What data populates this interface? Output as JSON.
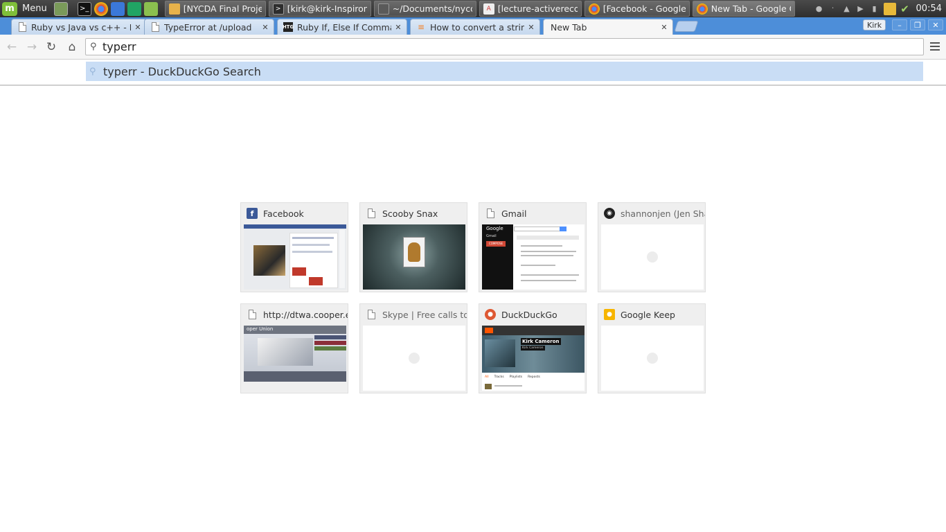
{
  "taskbar": {
    "menu_label": "Menu",
    "tasks": [
      {
        "label": "[NYCDA Final Project]",
        "icon": "folder-icon",
        "color": "#e7b24a"
      },
      {
        "label": "[kirk@kirk-Inspiron-...",
        "icon": "terminal-icon",
        "color": "#2d2d2d"
      },
      {
        "label": "~/Documents/nycd...",
        "icon": "text-editor-icon",
        "color": "#3a3a3a"
      },
      {
        "label": "[lecture-activerecor...",
        "icon": "pdf-icon",
        "color": "#d9d9d9"
      },
      {
        "label": "[Facebook - Google ...",
        "icon": "chrome-icon",
        "color": "#dd4b39"
      },
      {
        "label": "New Tab - Google C...",
        "icon": "chrome-icon",
        "color": "#dd4b39"
      }
    ],
    "clock": "00:54"
  },
  "browser": {
    "tabs": [
      {
        "title": "Ruby vs Java vs c++ - Rub",
        "icon": "page-icon"
      },
      {
        "title": "TypeError at /upload",
        "icon": "page-icon"
      },
      {
        "title": "Ruby If, Else If Commanc",
        "icon": "htg-icon"
      },
      {
        "title": "How to convert a string t",
        "icon": "stackoverflow-icon"
      },
      {
        "title": "New Tab",
        "icon": "none",
        "active": true
      }
    ],
    "profile": "Kirk",
    "omnibox": {
      "value": "typerr"
    },
    "suggestion": {
      "query": "typerr",
      "separator": " - ",
      "engine": "DuckDuckGo Search"
    }
  },
  "most_visited": [
    {
      "title": "Facebook",
      "icon": "facebook-icon",
      "thumb": "facebook"
    },
    {
      "title": "Scooby Snax",
      "icon": "page-icon",
      "thumb": "scooby"
    },
    {
      "title": "Gmail",
      "icon": "page-icon",
      "thumb": "gmail"
    },
    {
      "title": "shannonjen (Jen Shan",
      "icon": "github-icon",
      "thumb": "loading"
    },
    {
      "title": "http://dtwa.cooper.edu",
      "icon": "page-icon",
      "thumb": "cooper"
    },
    {
      "title": "Skype | Free calls to fr",
      "icon": "page-icon",
      "thumb": "loading"
    },
    {
      "title": "DuckDuckGo",
      "icon": "duckduckgo-icon",
      "thumb": "soundcloud"
    },
    {
      "title": "Google Keep",
      "icon": "keep-icon",
      "thumb": "loading"
    }
  ],
  "thumb_text": {
    "gmail_logo": "Google",
    "gmail_label": "Gmail",
    "gmail_compose": "COMPOSE",
    "sc_name": "Kirk Cameron",
    "sc_sub": "Kirk Cameron",
    "sc_tabs": [
      "All",
      "Tracks",
      "Playlists",
      "Reposts"
    ],
    "cooper_header": "oper Union"
  }
}
